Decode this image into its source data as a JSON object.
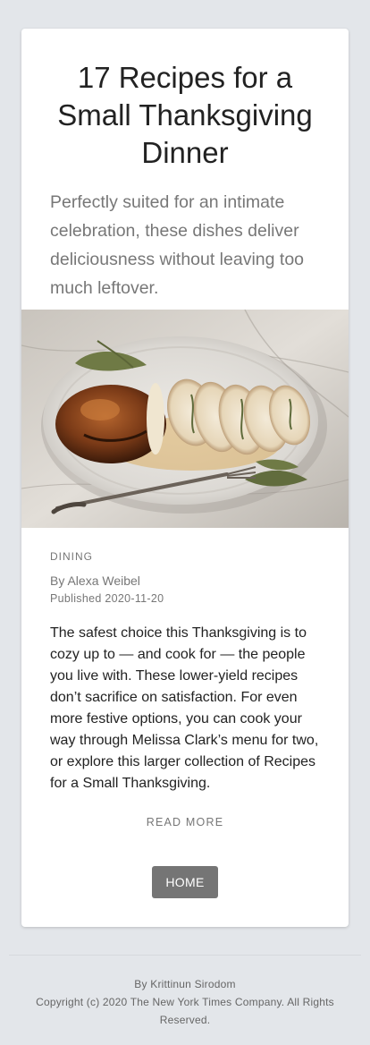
{
  "article": {
    "title": "17 Recipes for a Small Thanksgiving Dinner",
    "summary": "Perfectly suited for an intimate celebration, these dishes deliver deliciousness without leaving too much leftover.",
    "section": "DINING",
    "byline": "By Alexa Weibel",
    "published": "Published 2020-11-20",
    "abstract": "The safest choice this Thanksgiving is to cozy up to — and cook for — the people you live with. These lower-yield recipes don’t sacrifice on satisfaction. For even more festive options, you can cook your way through Melissa Clark’s menu for two, or explore this larger collection of Recipes for a Small Thanksgiving.",
    "read_more": "READ MORE",
    "image_subject": "sliced stuffed turkey breast on a white platter with a carving fork and sage leaves on marble"
  },
  "actions": {
    "home_label": "HOME"
  },
  "footer": {
    "author": "By Krittinun Sirodom",
    "copyright": "Copyright (c) 2020 The New York Times Company. All Rights Reserved."
  },
  "colors": {
    "page_background": "#e3e6ea",
    "card_background": "#ffffff",
    "button_background": "#757575",
    "muted_text": "#777777"
  }
}
